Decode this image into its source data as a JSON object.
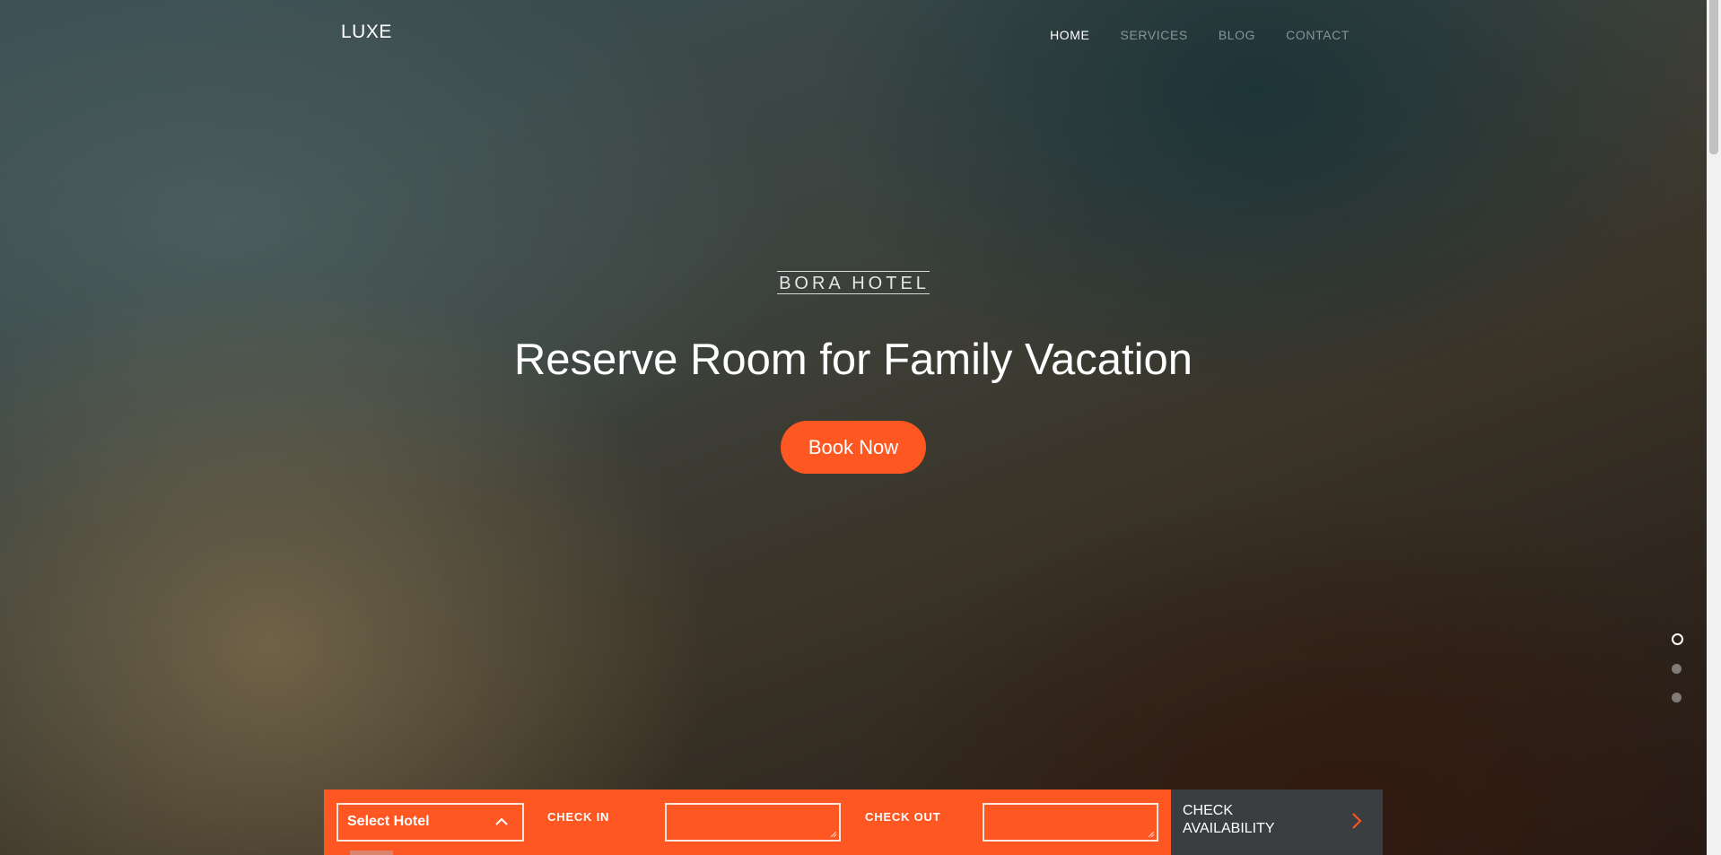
{
  "brand": {
    "logo": "LUXE"
  },
  "nav": {
    "items": [
      {
        "label": "HOME",
        "active": true
      },
      {
        "label": "SERVICES",
        "active": false
      },
      {
        "label": "BLOG",
        "active": false
      },
      {
        "label": "CONTACT",
        "active": false
      }
    ]
  },
  "hero": {
    "eyebrow": "BORA HOTEL",
    "headline": "Reserve Room for Family Vacation",
    "cta_label": "Book Now",
    "slides_total": 3,
    "active_slide": 1
  },
  "booking": {
    "select_hotel": "Select Hotel",
    "check_in_label": "CHECK IN",
    "check_in_value": "",
    "check_out_label": "CHECK OUT",
    "check_out_value": "",
    "submit_label": "CHECK AVAILABILITY"
  },
  "colors": {
    "accent": "#ff5722",
    "booking_dark": "#3b3e40",
    "text": "#ffffff"
  }
}
